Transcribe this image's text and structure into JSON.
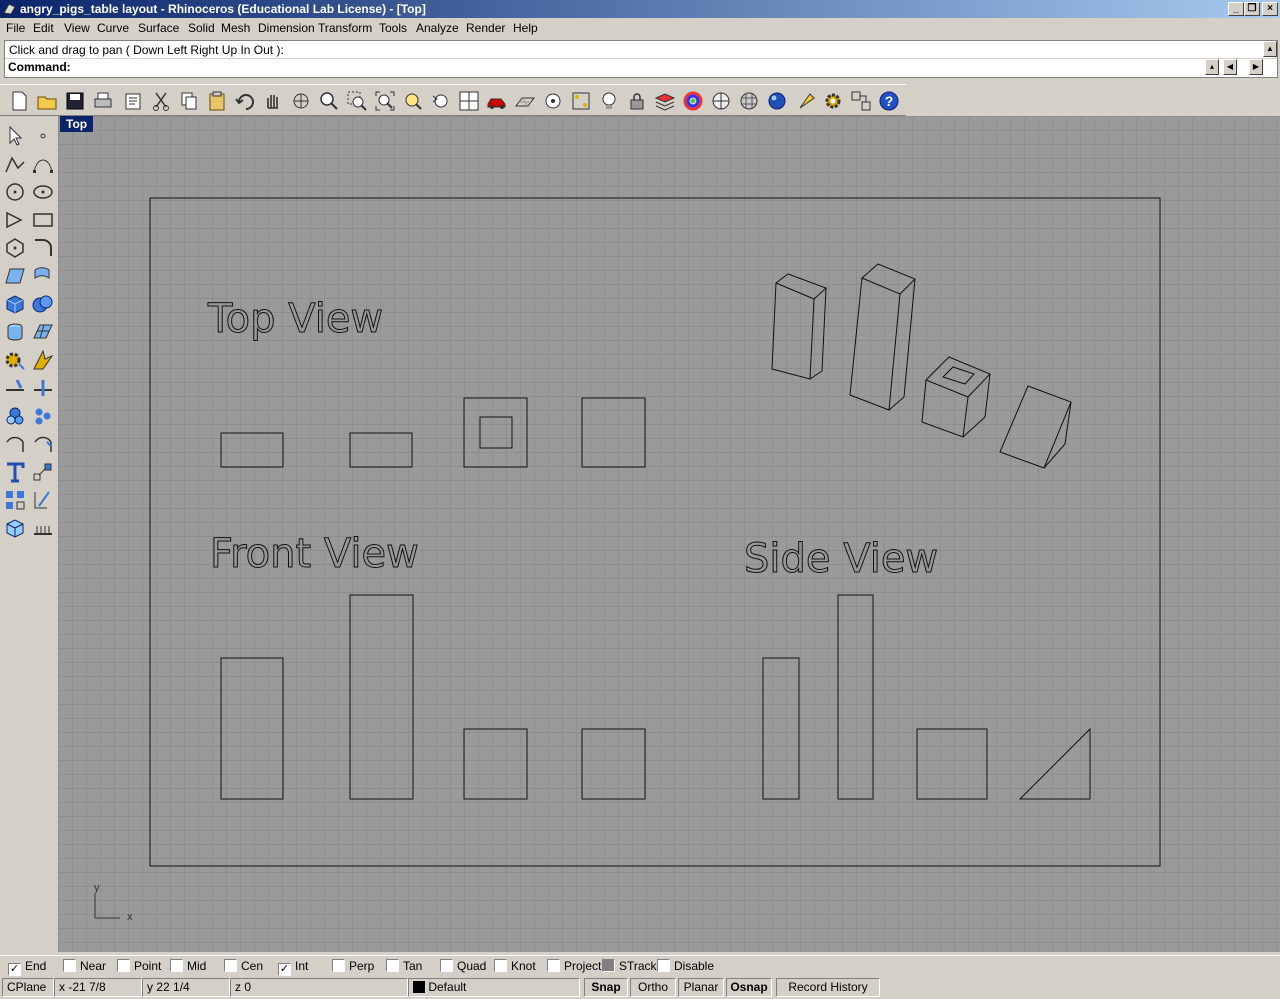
{
  "window": {
    "title": "angry_pigs_table layout - Rhinoceros (Educational Lab License) - [Top]"
  },
  "menu": [
    "File",
    "Edit",
    "View",
    "Curve",
    "Surface",
    "Solid",
    "Mesh",
    "Dimension",
    "Transform",
    "Tools",
    "Analyze",
    "Render",
    "Help"
  ],
  "command": {
    "history": "Click and drag to pan ( Down  Left  Right  Up  In  Out ):",
    "prompt_label": "Command:",
    "input_value": ""
  },
  "viewport": {
    "title": "Top",
    "labels": {
      "top_view": "Top View",
      "front_view": "Front View",
      "side_view": "Side View"
    },
    "axis_y": "y",
    "axis_x": "x"
  },
  "osnaps": [
    {
      "label": "End",
      "checked": true
    },
    {
      "label": "Near",
      "checked": false
    },
    {
      "label": "Point",
      "checked": false
    },
    {
      "label": "Mid",
      "checked": false
    },
    {
      "label": "Cen",
      "checked": false
    },
    {
      "label": "Int",
      "checked": true
    },
    {
      "label": "Perp",
      "checked": false
    },
    {
      "label": "Tan",
      "checked": false
    },
    {
      "label": "Quad",
      "checked": false
    },
    {
      "label": "Knot",
      "checked": false
    },
    {
      "label": "Project",
      "checked": false
    },
    {
      "label": "STrack",
      "checked": false
    },
    {
      "label": "Disable",
      "checked": false
    }
  ],
  "status": {
    "cplane": "CPlane",
    "x": "x -21 7/8",
    "y": "y 22 1/4",
    "z": "z 0",
    "layer": "Default",
    "snap": "Snap",
    "ortho": "Ortho",
    "planar": "Planar",
    "osnap": "Osnap",
    "record_history": "Record History"
  },
  "colors": {
    "titlebar": "#0a246a",
    "viewport": "#9a9a9a",
    "grid": "#8e8e8e",
    "layer_swatch": "#000000"
  }
}
